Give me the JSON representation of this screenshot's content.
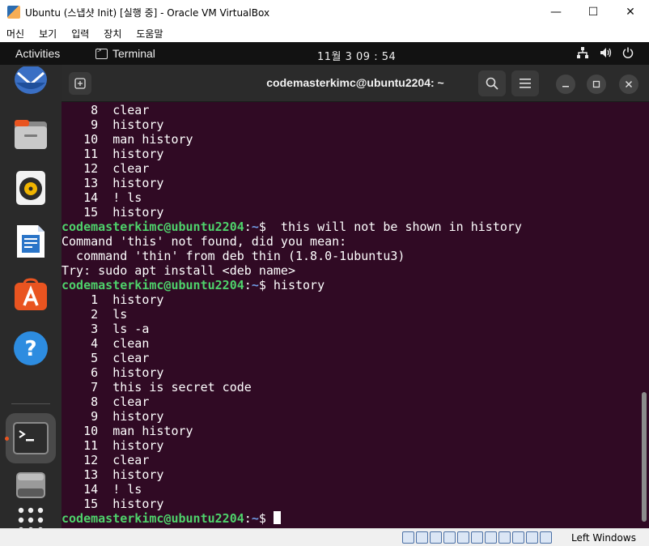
{
  "window": {
    "title": "Ubuntu (스냅샷 Init) [실행 중] - Oracle VM VirtualBox",
    "minimize_glyph": "—",
    "maximize_glyph": "☐",
    "close_glyph": "✕"
  },
  "menubar": {
    "items": [
      {
        "label": "머신"
      },
      {
        "label": "보기"
      },
      {
        "label": "입력"
      },
      {
        "label": "장치"
      },
      {
        "label": "도움말"
      }
    ]
  },
  "gnome_topbar": {
    "activities": "Activities",
    "app_name": "Terminal",
    "clock": "11월 3  09 : 54",
    "tray_icons": [
      "network-icon",
      "volume-icon",
      "power-icon"
    ]
  },
  "dock": {
    "items": [
      {
        "name": "thunderbird-icon"
      },
      {
        "name": "files-icon"
      },
      {
        "name": "rhythmbox-icon"
      },
      {
        "name": "libreoffice-writer-icon"
      },
      {
        "name": "ubuntu-software-icon"
      },
      {
        "name": "help-icon"
      },
      {
        "name": "terminal-icon",
        "active": true
      },
      {
        "name": "drive-icon"
      },
      {
        "name": "show-apps-icon"
      }
    ]
  },
  "terminal": {
    "title": "codemasterkimc@ubuntu2204: ~",
    "prompt": {
      "user_host": "codemasterkimc@ubuntu2204",
      "sep": ":",
      "dir": "~",
      "sym": "$"
    },
    "lines": [
      {
        "type": "out",
        "text": "    8  clear"
      },
      {
        "type": "out",
        "text": "    9  history"
      },
      {
        "type": "out",
        "text": "   10  man history"
      },
      {
        "type": "out",
        "text": "   11  history"
      },
      {
        "type": "out",
        "text": "   12  clear"
      },
      {
        "type": "out",
        "text": "   13  history"
      },
      {
        "type": "out",
        "text": "   14  ! ls"
      },
      {
        "type": "out",
        "text": "   15  history"
      },
      {
        "type": "prompt",
        "cmd": "  this will not be shown in history"
      },
      {
        "type": "out",
        "text": "Command 'this' not found, did you mean:"
      },
      {
        "type": "out",
        "text": "  command 'thin' from deb thin (1.8.0-1ubuntu3)"
      },
      {
        "type": "out",
        "text": "Try: sudo apt install <deb name>"
      },
      {
        "type": "prompt",
        "cmd": " history"
      },
      {
        "type": "out",
        "text": "    1  history"
      },
      {
        "type": "out",
        "text": "    2  ls"
      },
      {
        "type": "out",
        "text": "    3  ls -a"
      },
      {
        "type": "out",
        "text": "    4  clean"
      },
      {
        "type": "out",
        "text": "    5  clear"
      },
      {
        "type": "out",
        "text": "    6  history"
      },
      {
        "type": "out",
        "text": "    7  this is secret code"
      },
      {
        "type": "out",
        "text": "    8  clear"
      },
      {
        "type": "out",
        "text": "    9  history"
      },
      {
        "type": "out",
        "text": "   10  man history"
      },
      {
        "type": "out",
        "text": "   11  history"
      },
      {
        "type": "out",
        "text": "   12  clear"
      },
      {
        "type": "out",
        "text": "   13  history"
      },
      {
        "type": "out",
        "text": "   14  ! ls"
      },
      {
        "type": "out",
        "text": "   15  history"
      },
      {
        "type": "prompt",
        "cmd": " ",
        "cursor": true
      }
    ]
  },
  "statusbar": {
    "host_key": "Left Windows"
  },
  "colors": {
    "terminal_bg": "#300a24",
    "prompt_user": "#4ed26b",
    "prompt_dir": "#6f9ae4",
    "ubuntu_orange": "#e95420"
  }
}
